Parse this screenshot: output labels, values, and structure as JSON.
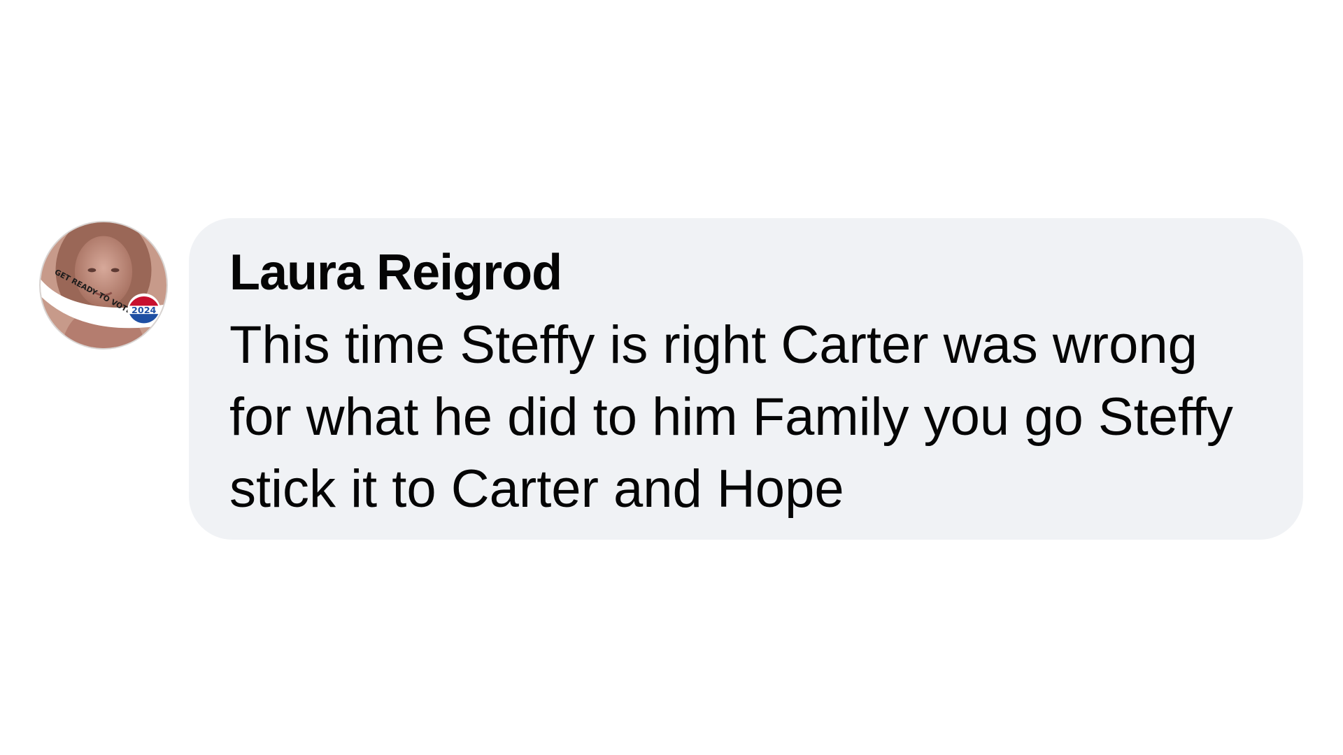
{
  "comment": {
    "author": "Laura Reigrod",
    "text": "This time Steffy is right Carter was wrong for what he did to him Family you go Steffy stick it to Carter and Hope",
    "avatar": {
      "icon": "profile-photo-avatar",
      "badge_text": "GET READY TO VOTE",
      "badge_year": "2024"
    }
  },
  "colors": {
    "bubble_background": "#f0f2f5",
    "text": "#050505",
    "page_background": "#ffffff"
  }
}
